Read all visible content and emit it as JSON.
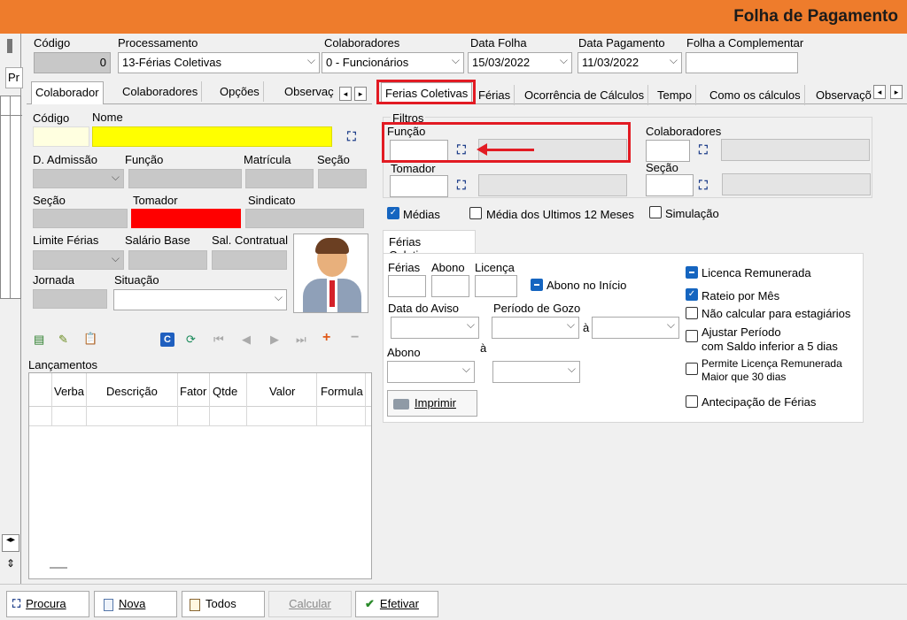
{
  "title": "Folha de Pagamento",
  "header": {
    "codigo_label": "Código",
    "codigo_value": "0",
    "processamento_label": "Processamento",
    "processamento_value": "13-Férias Coletivas",
    "colaboradores_label": "Colaboradores",
    "colaboradores_value": "0 - Funcionários",
    "data_folha_label": "Data Folha",
    "data_folha_value": "15/03/2022",
    "data_pagamento_label": "Data Pagamento",
    "data_pagamento_value": "11/03/2022",
    "folha_complementar_label": "Folha a Complementar",
    "left_stub": "Pr"
  },
  "left_tabs": [
    "Colaborador",
    "Colaboradores",
    "Opções",
    "Observaç"
  ],
  "right_tabs": [
    "Ferias Coletivas",
    "Férias",
    "Ocorrência de Cálculos",
    "Tempo",
    "Como os cálculos",
    "Observaçõ"
  ],
  "colaborador": {
    "codigo": "Código",
    "nome": "Nome",
    "d_admissao": "D. Admissão",
    "funcao": "Função",
    "matricula": "Matrícula",
    "secao_top": "Seção",
    "secao": "Seção",
    "tomador": "Tomador",
    "sindicato": "Sindicato",
    "limite_ferias": "Limite Férias",
    "salario_base": "Salário Base",
    "sal_contratual": "Sal. Contratual",
    "jornada": "Jornada",
    "situacao": "Situação",
    "lancamentos": "Lançamentos"
  },
  "lancamentos_columns": [
    "Verba",
    "Descrição",
    "Fator",
    "Qtde",
    "Valor",
    "Formula"
  ],
  "filtros": {
    "title": "Filtros",
    "funcao": "Função",
    "colaboradores": "Colaboradores",
    "tomador": "Tomador",
    "secao": "Seção"
  },
  "options": {
    "medias": "Médias",
    "media_ultimos": "Média dos Ultimos 12 Meses",
    "simulacao": "Simulação"
  },
  "ferias_coletivas": {
    "tab": "Férias Coletivas",
    "ferias": "Férias",
    "abono": "Abono",
    "licenca": "Licença",
    "abono_inicio": "Abono no Início",
    "data_aviso": "Data do Aviso",
    "periodo_gozo": "Período de Gozo",
    "a1": "à",
    "abono2": "Abono",
    "a2": "à",
    "imprimir": "Imprimir",
    "licenca_remunerada": "Licenca Remunerada",
    "rateio": "Rateio por Mês",
    "nao_calcular": "Não calcular para estagiários",
    "ajustar1": "Ajustar Período",
    "ajustar2": "com Saldo inferior a 5 dias",
    "permite1": "Permite Licença Remunerada",
    "permite2": "Maior que 30 dias",
    "antecipacao": "Antecipação de Férias"
  },
  "bottom": {
    "procura": "Procura",
    "nova": "Nova",
    "todos": "Todos",
    "calcular": "Calcular",
    "efetivar": "Efetivar"
  }
}
